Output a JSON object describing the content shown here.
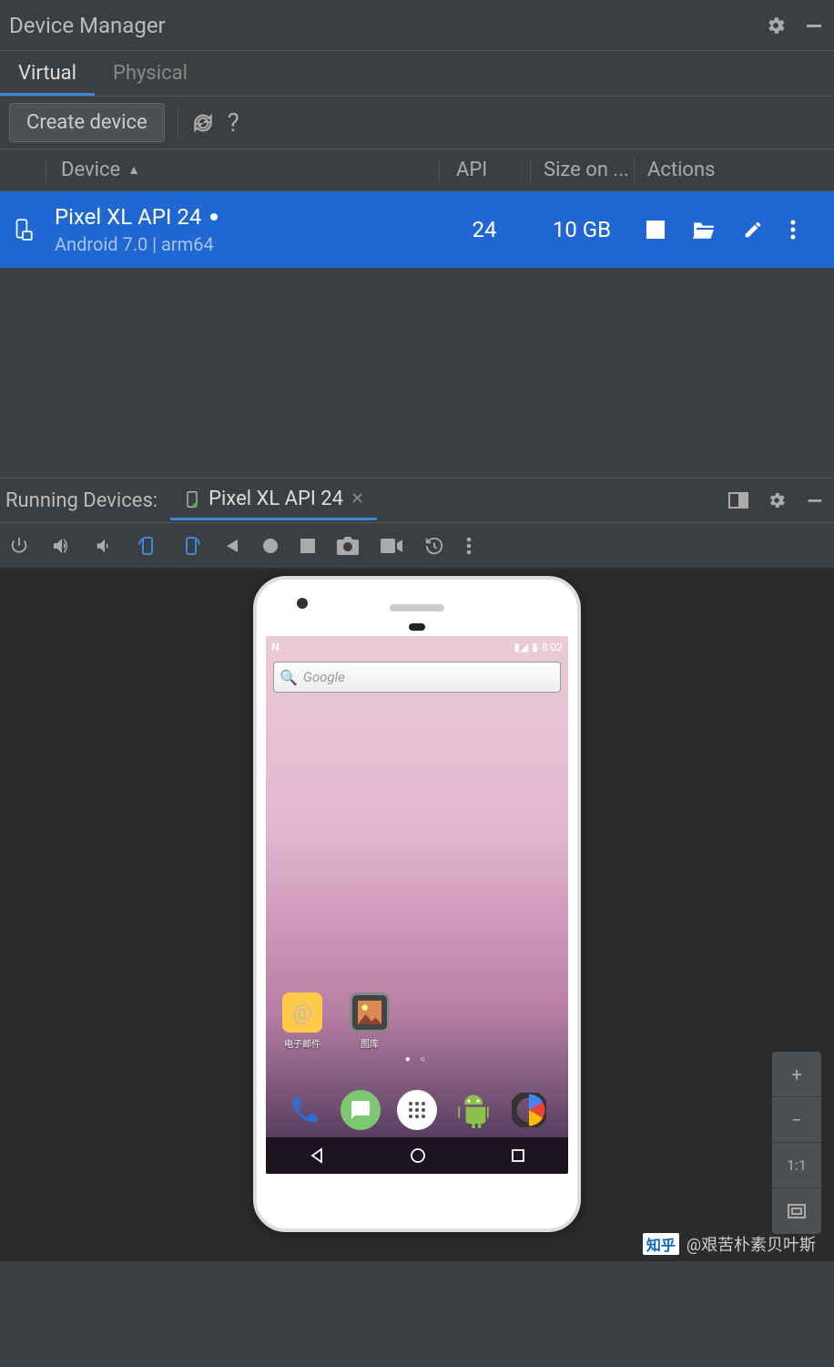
{
  "deviceManager": {
    "title": "Device Manager",
    "tabs": {
      "virtual": "Virtual",
      "physical": "Physical"
    },
    "createButton": "Create device",
    "columns": {
      "device": "Device",
      "api": "API",
      "size": "Size on ...",
      "actions": "Actions"
    },
    "rows": [
      {
        "name": "Pixel XL API 24",
        "sub": "Android 7.0 | arm64",
        "api": "24",
        "size": "10 GB"
      }
    ]
  },
  "runningDevices": {
    "title": "Running Devices:",
    "tab": "Pixel XL API 24"
  },
  "phone": {
    "time": "8:02",
    "searchPlaceholder": "Google",
    "apps": {
      "email": "电子邮件",
      "gallery": "图库"
    }
  },
  "zoom": {
    "in": "+",
    "out": "−",
    "one": "1:1"
  },
  "watermark": {
    "brand": "知乎",
    "user": "@艰苦朴素贝叶斯"
  }
}
